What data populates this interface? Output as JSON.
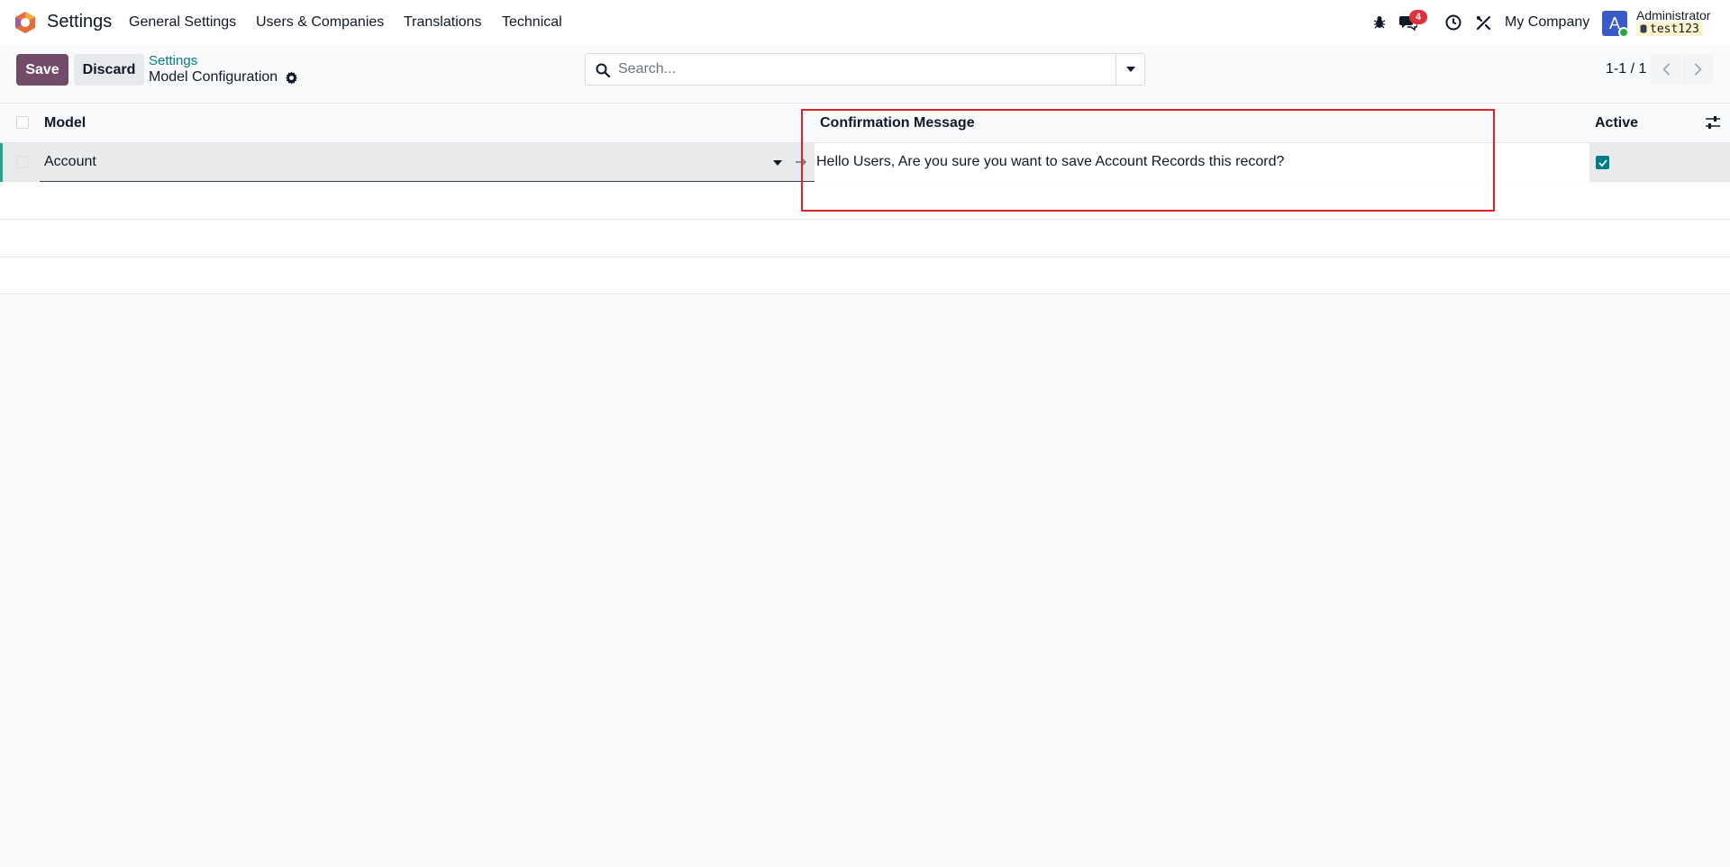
{
  "navbar": {
    "app_name": "Settings",
    "menu": [
      "General Settings",
      "Users & Companies",
      "Translations",
      "Technical"
    ],
    "messages_count": "4",
    "company": "My Company",
    "user_initial": "A",
    "user_name": "Administrator",
    "database": "test123"
  },
  "control": {
    "save_label": "Save",
    "discard_label": "Discard",
    "breadcrumb_parent": "Settings",
    "breadcrumb_current": "Model Configuration",
    "search_placeholder": "Search...",
    "pager": "1-1 / 1"
  },
  "list": {
    "columns": [
      "Model",
      "Confirmation Message",
      "Active"
    ],
    "rows": [
      {
        "model": "Account",
        "confirmation_message": "Hello Users, Are you sure you want to save Account Records this record?",
        "active": true
      }
    ]
  },
  "colors": {
    "brand": "#714b67",
    "accent": "#017e84",
    "highlight": "#e0202a",
    "badge": "#e0313d"
  }
}
